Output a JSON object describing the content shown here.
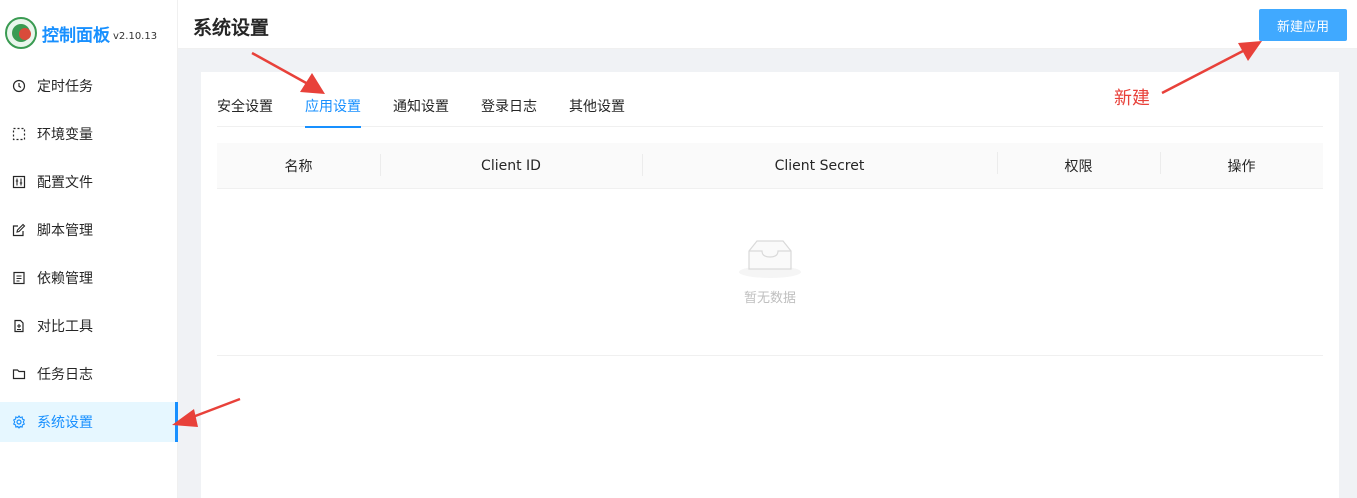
{
  "app": {
    "title": "控制面板",
    "version": "v2.10.13"
  },
  "sidebar": {
    "items": [
      {
        "label": "定时任务",
        "icon": "clock-icon"
      },
      {
        "label": "环境变量",
        "icon": "dashed-box-icon"
      },
      {
        "label": "配置文件",
        "icon": "sliders-icon"
      },
      {
        "label": "脚本管理",
        "icon": "edit-icon"
      },
      {
        "label": "依赖管理",
        "icon": "package-icon"
      },
      {
        "label": "对比工具",
        "icon": "diff-icon"
      },
      {
        "label": "任务日志",
        "icon": "folder-icon"
      },
      {
        "label": "系统设置",
        "icon": "gear-icon",
        "active": true
      }
    ]
  },
  "header": {
    "title": "系统设置",
    "new_app_button": "新建应用"
  },
  "tabs": [
    {
      "label": "安全设置"
    },
    {
      "label": "应用设置",
      "active": true
    },
    {
      "label": "通知设置"
    },
    {
      "label": "登录日志"
    },
    {
      "label": "其他设置"
    }
  ],
  "table": {
    "columns": [
      "名称",
      "Client ID",
      "Client Secret",
      "权限",
      "操作"
    ],
    "rows": [],
    "empty_text": "暂无数据"
  },
  "annotation": {
    "label": "新建"
  },
  "colors": {
    "primary": "#1890ff",
    "button": "#40a9ff",
    "annotation": "#e8413a",
    "active_bg": "#e6f7ff"
  }
}
